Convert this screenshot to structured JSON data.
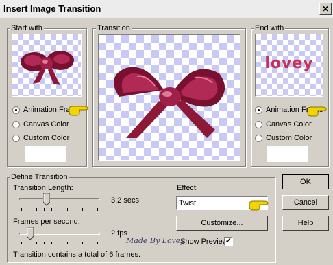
{
  "window": {
    "title": "Insert Image Transition",
    "close_icon": "close-icon"
  },
  "start_with": {
    "label": "Start with",
    "options": [
      "Animation Frame",
      "Canvas Color",
      "Custom Color"
    ],
    "selected": "Animation Frame"
  },
  "transition": {
    "label": "Transition"
  },
  "end_with": {
    "label": "End with",
    "preview_text": "lovey",
    "options": [
      "Animation Frame",
      "Canvas Color",
      "Custom Color"
    ],
    "selected": "Animation Frame"
  },
  "define": {
    "label": "Define Transition",
    "length_label": "Transition Length:",
    "length_value": "3.2 secs",
    "length_fraction": 0.32,
    "fps_label": "Frames per second:",
    "fps_value": "2 fps",
    "fps_fraction": 0.1,
    "effect_label": "Effect:",
    "effect_value": "Twist",
    "customize_label": "Customize...",
    "show_preview_label": "Show Preview",
    "show_preview_checked": true,
    "summary": "Transition contains a total of 6 frames."
  },
  "buttons": {
    "ok": "OK",
    "cancel": "Cancel",
    "help": "Help"
  },
  "watermark": "Made By Lovey",
  "colors": {
    "bow_dark": "#7a1030",
    "bow_mid": "#b02a55",
    "bow_light": "#e07a9a",
    "checker": "#c9c9f5",
    "lovey_text": "#c8305a",
    "hand": "#f2d400"
  }
}
